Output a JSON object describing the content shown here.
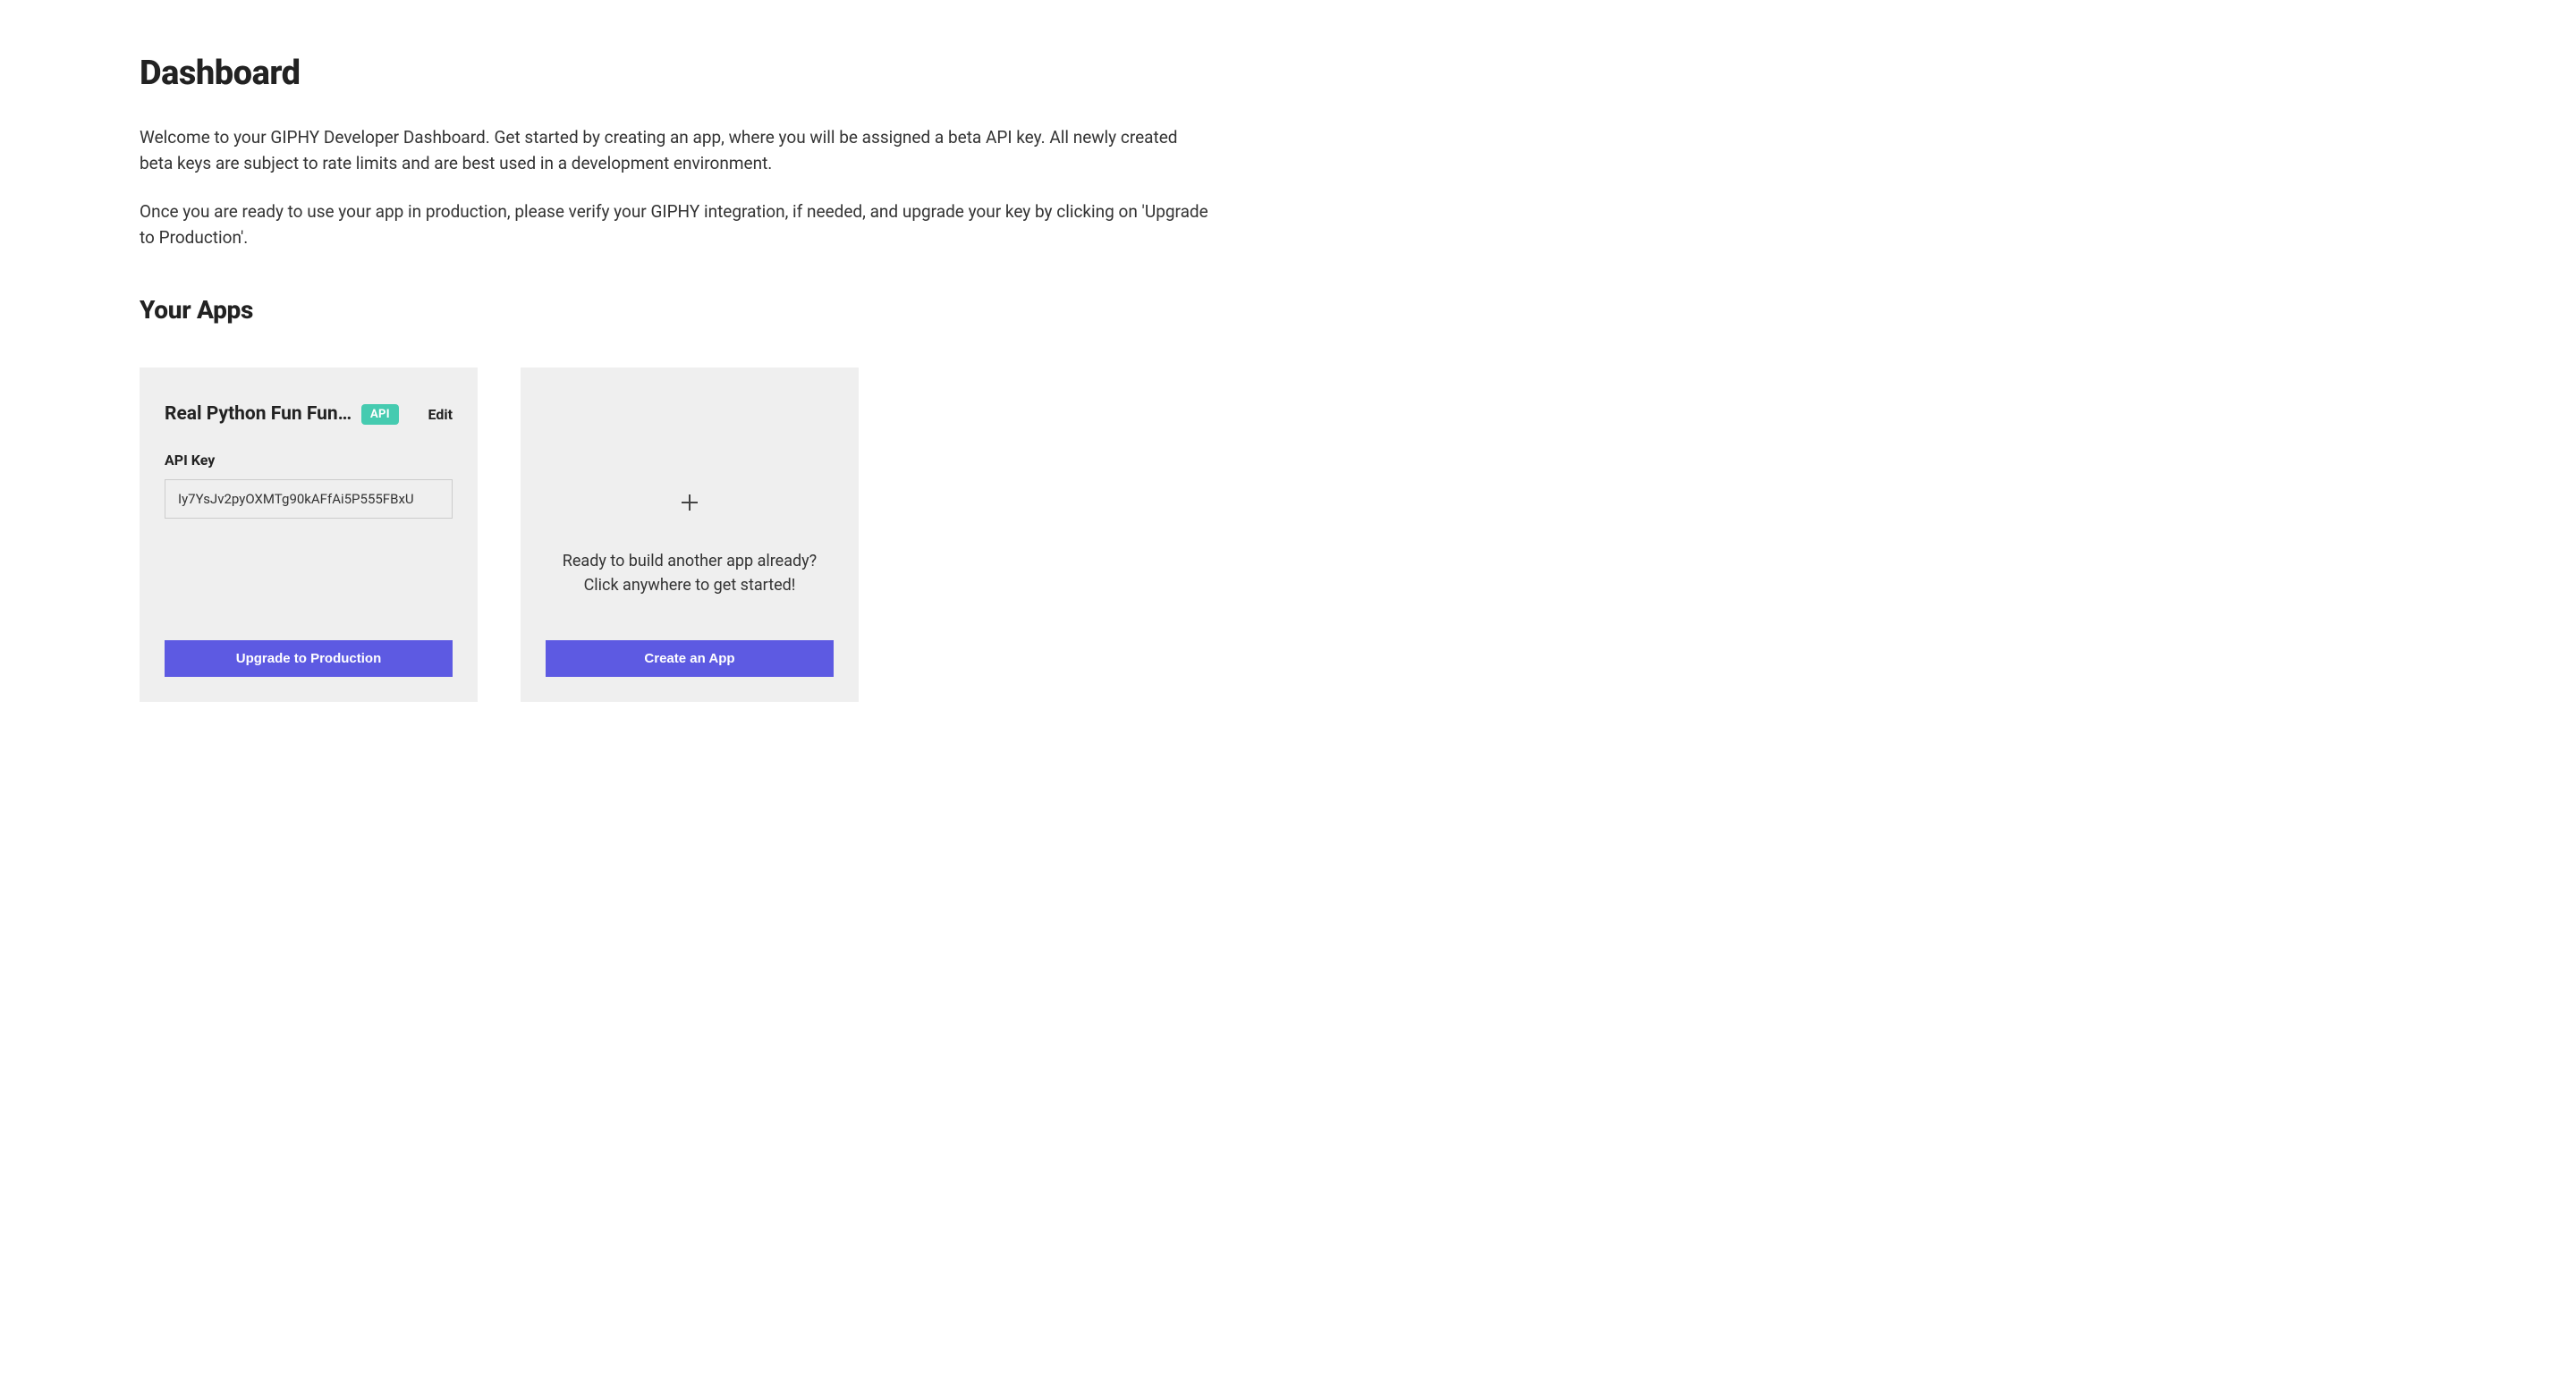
{
  "page": {
    "title": "Dashboard",
    "intro_paragraph_1": "Welcome to your GIPHY Developer Dashboard. Get started by creating an app, where you will be assigned a beta API key. All newly created beta keys are subject to rate limits and are best used in a development environment.",
    "intro_paragraph_2": "Once you are ready to use your app in production, please verify your GIPHY integration, if needed, and upgrade your key by clicking on 'Upgrade to Production'."
  },
  "apps_section": {
    "title": "Your Apps"
  },
  "app": {
    "name": "Real Python Fun Fun F…",
    "badge": "API",
    "edit_label": "Edit",
    "api_key_label": "API Key",
    "api_key_value": "Iy7YsJv2pyOXMTg90kAFfAi5P555FBxU",
    "upgrade_button": "Upgrade to Production"
  },
  "new_app": {
    "prompt_line_1": "Ready to build another app already?",
    "prompt_line_2": "Click anywhere to get started!",
    "create_button": "Create an App"
  }
}
